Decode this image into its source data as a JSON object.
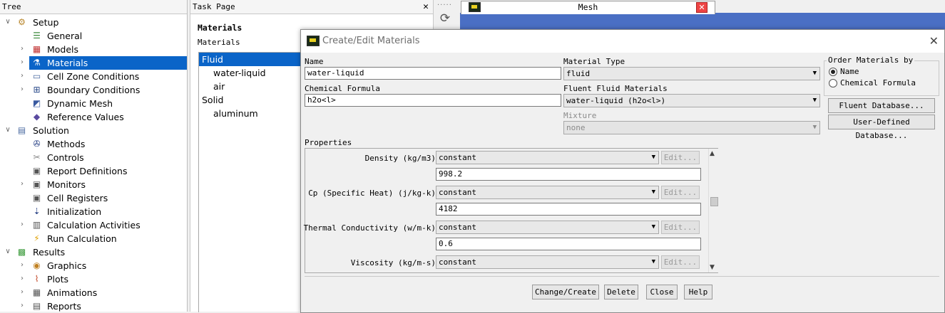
{
  "tree": {
    "header": "Tree",
    "items": [
      {
        "label": "Setup",
        "level": 0,
        "expanded": true,
        "icon": "setup-icon"
      },
      {
        "label": "General",
        "level": 1,
        "icon": "general-icon"
      },
      {
        "label": "Models",
        "level": 1,
        "collapsed": true,
        "icon": "models-icon"
      },
      {
        "label": "Materials",
        "level": 1,
        "collapsed": true,
        "selected": true,
        "icon": "materials-icon"
      },
      {
        "label": "Cell Zone Conditions",
        "level": 1,
        "collapsed": true,
        "icon": "cell-zone-icon"
      },
      {
        "label": "Boundary Conditions",
        "level": 1,
        "collapsed": true,
        "icon": "boundary-icon"
      },
      {
        "label": "Dynamic Mesh",
        "level": 1,
        "icon": "dynamic-mesh-icon"
      },
      {
        "label": "Reference Values",
        "level": 1,
        "icon": "reference-values-icon"
      },
      {
        "label": "Solution",
        "level": 0,
        "expanded": true,
        "icon": "solution-icon"
      },
      {
        "label": "Methods",
        "level": 1,
        "icon": "methods-icon"
      },
      {
        "label": "Controls",
        "level": 1,
        "icon": "controls-icon"
      },
      {
        "label": "Report Definitions",
        "level": 1,
        "icon": "report-definitions-icon"
      },
      {
        "label": "Monitors",
        "level": 1,
        "collapsed": true,
        "icon": "monitors-icon"
      },
      {
        "label": "Cell Registers",
        "level": 1,
        "icon": "cell-registers-icon"
      },
      {
        "label": "Initialization",
        "level": 1,
        "icon": "initialization-icon"
      },
      {
        "label": "Calculation Activities",
        "level": 1,
        "collapsed": true,
        "icon": "calculation-activities-icon"
      },
      {
        "label": "Run Calculation",
        "level": 1,
        "icon": "run-calculation-icon"
      },
      {
        "label": "Results",
        "level": 0,
        "expanded": true,
        "icon": "results-icon"
      },
      {
        "label": "Graphics",
        "level": 1,
        "collapsed": true,
        "icon": "graphics-icon"
      },
      {
        "label": "Plots",
        "level": 1,
        "collapsed": true,
        "icon": "plots-icon"
      },
      {
        "label": "Animations",
        "level": 1,
        "collapsed": true,
        "icon": "animations-icon"
      },
      {
        "label": "Reports",
        "level": 1,
        "collapsed": true,
        "icon": "reports-icon"
      }
    ]
  },
  "task_page": {
    "header": "Task Page",
    "close": "✕",
    "title": "Materials",
    "materials_label": "Materials",
    "list": [
      {
        "label": "Fluid",
        "selected": true,
        "child": false
      },
      {
        "label": "water-liquid",
        "child": true
      },
      {
        "label": "air",
        "child": true
      },
      {
        "label": "Solid",
        "child": false
      },
      {
        "label": "aluminum",
        "child": true
      }
    ]
  },
  "mesh_tab": {
    "title": "Mesh",
    "close": "✕"
  },
  "dialog": {
    "title": "Create/Edit Materials",
    "close": "✕",
    "name_label": "Name",
    "name_value": "water-liquid",
    "chem_label": "Chemical Formula",
    "chem_value": "h2o<l>",
    "material_type_label": "Material Type",
    "material_type_value": "fluid",
    "fluent_fluid_label": "Fluent Fluid Materials",
    "fluent_fluid_value": "water-liquid (h2o<l>)",
    "mixture_label": "Mixture",
    "mixture_value": "none",
    "order_label": "Order Materials by",
    "order_options": [
      "Name",
      "Chemical Formula"
    ],
    "order_selected": "Name",
    "fluent_db_button": "Fluent Database...",
    "udf_db_button": "User-Defined Database...",
    "properties_label": "Properties",
    "properties": [
      {
        "label": "Density (kg/m3)",
        "method": "constant",
        "value": "998.2",
        "edit": "Edit..."
      },
      {
        "label": "Cp (Specific Heat) (j/kg-k)",
        "method": "constant",
        "value": "4182",
        "edit": "Edit..."
      },
      {
        "label": "Thermal Conductivity (w/m-k)",
        "method": "constant",
        "value": "0.6",
        "edit": "Edit..."
      },
      {
        "label": "Viscosity (kg/m-s)",
        "method": "constant",
        "edit": "Edit..."
      }
    ],
    "buttons": {
      "change_create": "Change/Create",
      "delete": "Delete",
      "close": "Close",
      "help": "Help"
    }
  }
}
